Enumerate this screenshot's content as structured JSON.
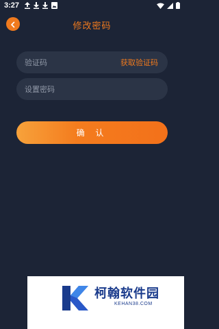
{
  "status_bar": {
    "time": "3:27",
    "left_icons": [
      "upload-icon",
      "download-icon",
      "download-icon",
      "image-icon"
    ],
    "right_icons": [
      "wifi-icon",
      "signal-icon",
      "battery-icon"
    ]
  },
  "header": {
    "back_icon": "chevron-left-icon",
    "title": "修改密码"
  },
  "form": {
    "code_placeholder": "验证码",
    "code_value": "",
    "get_code_label": "获取验证码",
    "password_placeholder": "设置密码",
    "password_value": ""
  },
  "confirm_label": "确 认",
  "watermark": {
    "logo_icon": "k-logo-icon",
    "name": "柯翰软件园",
    "domain": "KEHAN38.COM"
  },
  "colors": {
    "background": "#1c2436",
    "accent": "#f07a1e",
    "field_background": "#2b3446",
    "placeholder": "#8f97a6",
    "brand_blue": "#1a3b8c"
  }
}
